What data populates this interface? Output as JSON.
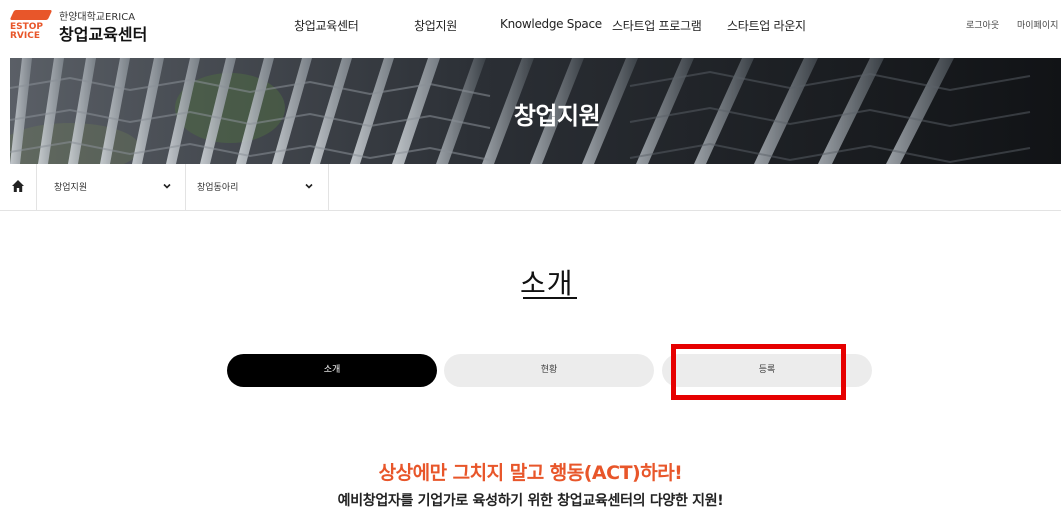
{
  "header": {
    "logo": {
      "mark_line1": "ESTOP",
      "mark_line2": "RVICE",
      "subtitle": "한양대학교ERICA",
      "title": "창업교육센터"
    },
    "nav": [
      {
        "label": "창업교육센터"
      },
      {
        "label": "창업지원"
      },
      {
        "label": "Knowledge Space"
      },
      {
        "label": "스타트업 프로그램"
      },
      {
        "label": "스타트업 라운지"
      }
    ],
    "logout_label": "로그아웃",
    "mypage_label": "마이페이지"
  },
  "banner": {
    "title": "창업지원"
  },
  "breadcrumb": {
    "home_icon": "home-icon",
    "level1": "창업지원",
    "level2": "창업동아리"
  },
  "section": {
    "title": "소개",
    "tabs": [
      {
        "label": "소개",
        "active": true
      },
      {
        "label": "현황",
        "active": false
      },
      {
        "label": "등록",
        "active": false
      }
    ]
  },
  "content": {
    "headline": "상상에만 그치지 말고 행동(ACT)하라!",
    "subline": "예비창업자를 기업가로 육성하기 위한 창업교육센터의 다양한 지원!"
  },
  "colors": {
    "brand": "#e8562a",
    "highlight": "#e60000",
    "tab_active": "#000000",
    "tab_idle": "#ececec"
  }
}
